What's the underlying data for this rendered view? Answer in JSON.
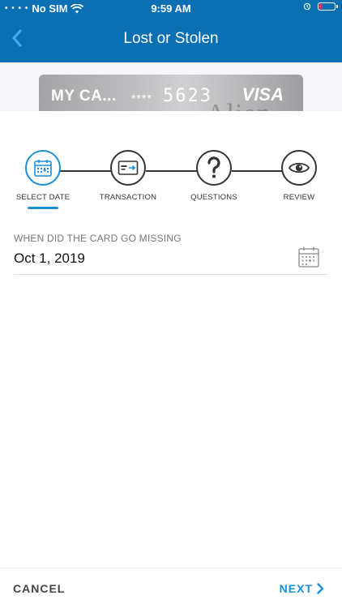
{
  "status_bar": {
    "carrier": "No SIM",
    "time": "9:59 AM"
  },
  "header": {
    "title": "Lost or Stolen",
    "back_icon": "chevron-left-icon"
  },
  "card": {
    "name": "MY CA...",
    "mask": "****",
    "last_digits": "5623",
    "brand": "VISA",
    "watermark": "Alien"
  },
  "stepper": {
    "steps": [
      {
        "label": "SELECT DATE",
        "icon": "calendar-icon",
        "active": true
      },
      {
        "label": "TRANSACTION",
        "icon": "card-transfer-icon",
        "active": false
      },
      {
        "label": "QUESTIONS",
        "icon": "question-mark-icon",
        "active": false
      },
      {
        "label": "REVIEW",
        "icon": "eye-icon",
        "active": false
      }
    ]
  },
  "form": {
    "date_label": "WHEN DID THE CARD GO MISSING",
    "date_value": "Oct 1, 2019"
  },
  "footer": {
    "cancel_label": "CANCEL",
    "next_label": "NEXT"
  },
  "colors": {
    "header_bg": "#0a6fb3",
    "accent": "#1b8fd6"
  }
}
